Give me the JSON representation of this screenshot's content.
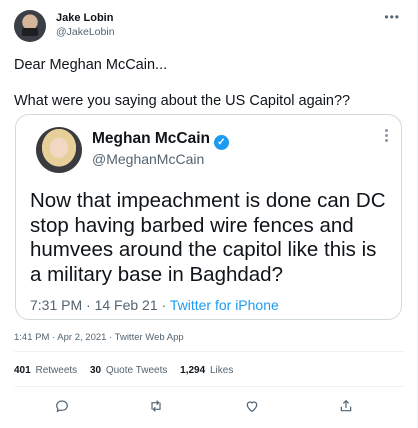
{
  "author": {
    "name": "Jake Lobin",
    "handle": "@JakeLobin",
    "more_icon": "•••"
  },
  "tweet": {
    "line1": "Dear Meghan McCain...",
    "line2": "What were you saying about the US Capitol again??"
  },
  "quoted": {
    "name": "Meghan McCain",
    "verified_icon": "✓",
    "handle": "@MeghanMcCain",
    "text": "Now that impeachment is done can DC stop having barbed wire fences and humvees around the capitol like this is a military base in Baghdad?",
    "time": "7:31 PM · 14 Feb 21",
    "separator": " · ",
    "source": "Twitter for iPhone"
  },
  "meta": "1:41 PM · Apr 2, 2021 · Twitter Web App",
  "stats": {
    "retweets_count": "401",
    "retweets_label": "Retweets",
    "quotes_count": "30",
    "quotes_label": "Quote Tweets",
    "likes_count": "1,294",
    "likes_label": "Likes"
  },
  "colors": {
    "accent": "#1d9bf0",
    "text": "#0f1419",
    "secondary": "#536471",
    "border": "#cfd9de"
  },
  "icons": {
    "reply": "reply-icon",
    "retweet": "retweet-icon",
    "like": "heart-icon",
    "share": "share-icon"
  }
}
